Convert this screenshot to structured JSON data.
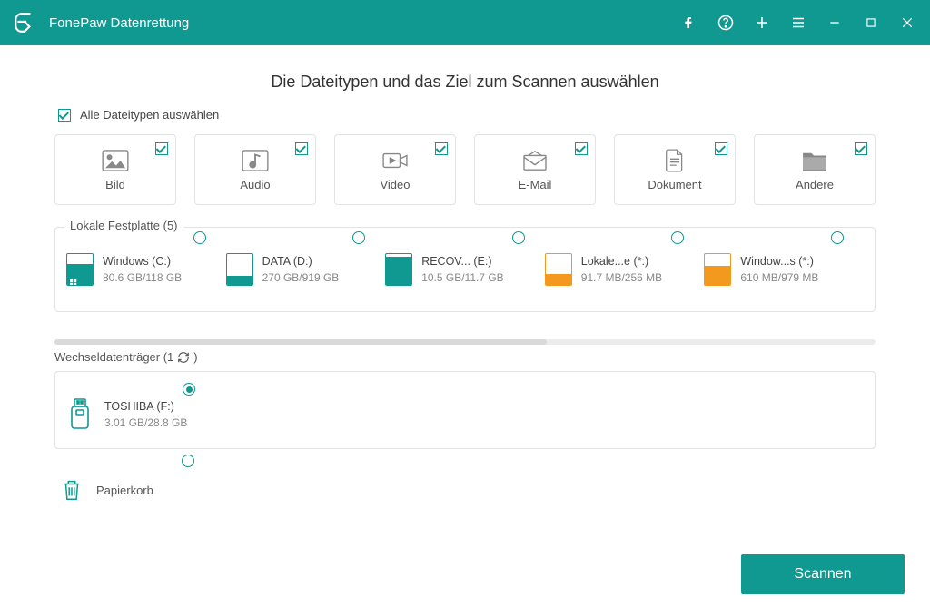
{
  "app": {
    "title": "FonePaw Datenrettung"
  },
  "page": {
    "heading": "Die Dateitypen und das Ziel zum Scannen auswählen",
    "select_all": "Alle Dateitypen auswählen"
  },
  "types": [
    {
      "id": "bild",
      "label": "Bild"
    },
    {
      "id": "audio",
      "label": "Audio"
    },
    {
      "id": "video",
      "label": "Video"
    },
    {
      "id": "email",
      "label": "E-Mail"
    },
    {
      "id": "dokument",
      "label": "Dokument"
    },
    {
      "id": "andere",
      "label": "Andere"
    }
  ],
  "local": {
    "legend": "Lokale Festplatte (5)",
    "drives": [
      {
        "name": "Windows (C:)",
        "size": "80.6 GB/118 GB",
        "fill": 68,
        "color": "teal",
        "win": true
      },
      {
        "name": "DATA (D:)",
        "size": "270 GB/919 GB",
        "fill": 30,
        "color": "teal",
        "win": false
      },
      {
        "name": "RECOV... (E:)",
        "size": "10.5 GB/11.7 GB",
        "fill": 90,
        "color": "teal",
        "win": false
      },
      {
        "name": "Lokale...e (*:)",
        "size": "91.7 MB/256 MB",
        "fill": 36,
        "color": "orange",
        "win": false
      },
      {
        "name": "Window...s (*:)",
        "size": "610 MB/979 MB",
        "fill": 62,
        "color": "orange",
        "win": false
      }
    ]
  },
  "removable": {
    "legend": "Wechseldatenträger (1",
    "drive": {
      "name": "TOSHIBA (F:)",
      "size": "3.01 GB/28.8 GB"
    }
  },
  "recycle": {
    "label": "Papierkorb"
  },
  "actions": {
    "scan": "Scannen"
  }
}
